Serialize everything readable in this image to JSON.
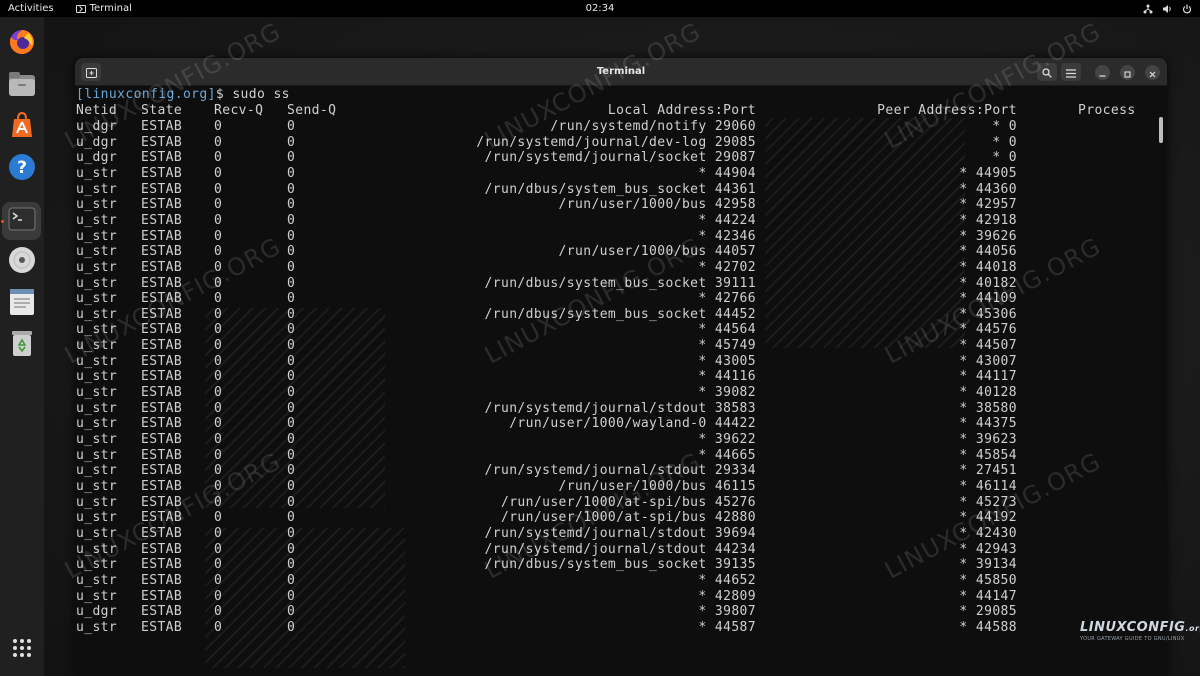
{
  "topbar": {
    "activities": "Activities",
    "app_name": "Terminal",
    "clock": "02:34"
  },
  "dock": {
    "items": [
      {
        "name": "firefox-icon"
      },
      {
        "name": "files-icon"
      },
      {
        "name": "app-center-icon"
      },
      {
        "name": "help-icon"
      },
      {
        "name": "terminal-icon",
        "active": true
      },
      {
        "name": "disc-icon"
      },
      {
        "name": "text-editor-icon"
      },
      {
        "name": "trash-icon"
      },
      {
        "name": "show-apps-icon"
      }
    ]
  },
  "window": {
    "title": "Terminal"
  },
  "terminal": {
    "prompt_host": "[linuxconfig.org]",
    "prompt_rest": "$ sudo ss",
    "headers": {
      "netid": "Netid",
      "state": "State",
      "recv": "Recv-Q",
      "send": "Send-Q",
      "local": "Local Address:Port",
      "peer": "Peer Address:Port",
      "process": "Process"
    },
    "rows": [
      [
        "u_dgr",
        "ESTAB",
        "0",
        "0",
        "/run/systemd/notify 29060",
        "* 0"
      ],
      [
        "u_dgr",
        "ESTAB",
        "0",
        "0",
        "/run/systemd/journal/dev-log 29085",
        "* 0"
      ],
      [
        "u_dgr",
        "ESTAB",
        "0",
        "0",
        "/run/systemd/journal/socket 29087",
        "* 0"
      ],
      [
        "u_str",
        "ESTAB",
        "0",
        "0",
        "* 44904",
        "* 44905"
      ],
      [
        "u_str",
        "ESTAB",
        "0",
        "0",
        "/run/dbus/system_bus_socket 44361",
        "* 44360"
      ],
      [
        "u_str",
        "ESTAB",
        "0",
        "0",
        "/run/user/1000/bus 42958",
        "* 42957"
      ],
      [
        "u_str",
        "ESTAB",
        "0",
        "0",
        "* 44224",
        "* 42918"
      ],
      [
        "u_str",
        "ESTAB",
        "0",
        "0",
        "* 42346",
        "* 39626"
      ],
      [
        "u_str",
        "ESTAB",
        "0",
        "0",
        "/run/user/1000/bus 44057",
        "* 44056"
      ],
      [
        "u_str",
        "ESTAB",
        "0",
        "0",
        "* 42702",
        "* 44018"
      ],
      [
        "u_str",
        "ESTAB",
        "0",
        "0",
        "/run/dbus/system_bus_socket 39111",
        "* 40182"
      ],
      [
        "u_str",
        "ESTAB",
        "0",
        "0",
        "* 42766",
        "* 44109"
      ],
      [
        "u_str",
        "ESTAB",
        "0",
        "0",
        "/run/dbus/system_bus_socket 44452",
        "* 45306"
      ],
      [
        "u_str",
        "ESTAB",
        "0",
        "0",
        "* 44564",
        "* 44576"
      ],
      [
        "u_str",
        "ESTAB",
        "0",
        "0",
        "* 45749",
        "* 44507"
      ],
      [
        "u_str",
        "ESTAB",
        "0",
        "0",
        "* 43005",
        "* 43007"
      ],
      [
        "u_str",
        "ESTAB",
        "0",
        "0",
        "* 44116",
        "* 44117"
      ],
      [
        "u_str",
        "ESTAB",
        "0",
        "0",
        "* 39082",
        "* 40128"
      ],
      [
        "u_str",
        "ESTAB",
        "0",
        "0",
        "/run/systemd/journal/stdout 38583",
        "* 38580"
      ],
      [
        "u_str",
        "ESTAB",
        "0",
        "0",
        "/run/user/1000/wayland-0 44422",
        "* 44375"
      ],
      [
        "u_str",
        "ESTAB",
        "0",
        "0",
        "* 39622",
        "* 39623"
      ],
      [
        "u_str",
        "ESTAB",
        "0",
        "0",
        "* 44665",
        "* 45854"
      ],
      [
        "u_str",
        "ESTAB",
        "0",
        "0",
        "/run/systemd/journal/stdout 29334",
        "* 27451"
      ],
      [
        "u_str",
        "ESTAB",
        "0",
        "0",
        "/run/user/1000/bus 46115",
        "* 46114"
      ],
      [
        "u_str",
        "ESTAB",
        "0",
        "0",
        "/run/user/1000/at-spi/bus 45276",
        "* 45273"
      ],
      [
        "u_str",
        "ESTAB",
        "0",
        "0",
        "/run/user/1000/at-spi/bus 42880",
        "* 44192"
      ],
      [
        "u_str",
        "ESTAB",
        "0",
        "0",
        "/run/systemd/journal/stdout 39694",
        "* 42430"
      ],
      [
        "u_str",
        "ESTAB",
        "0",
        "0",
        "/run/systemd/journal/stdout 44234",
        "* 42943"
      ],
      [
        "u_str",
        "ESTAB",
        "0",
        "0",
        "/run/dbus/system_bus_socket 39135",
        "* 39134"
      ],
      [
        "u_str",
        "ESTAB",
        "0",
        "0",
        "* 44652",
        "* 45850"
      ],
      [
        "u_str",
        "ESTAB",
        "0",
        "0",
        "* 42809",
        "* 44147"
      ],
      [
        "u_dgr",
        "ESTAB",
        "0",
        "0",
        "* 39807",
        "* 29085"
      ],
      [
        "u_str",
        "ESTAB",
        "0",
        "0",
        "* 44587",
        "* 44588"
      ]
    ]
  },
  "watermark": {
    "text": "LINUXCONFIG.ORG"
  },
  "brand": {
    "main": "LINUXCONFIG",
    "suffix": ".org",
    "tagline": "YOUR GATEWAY GUIDE TO GNU/LINUX"
  },
  "colors": {
    "prompt_host": "#6aa7d8",
    "terminal_text": "#d0d0d0",
    "terminal_bg": "#0e0e0e",
    "dock_active_dot": "#e9541f"
  }
}
